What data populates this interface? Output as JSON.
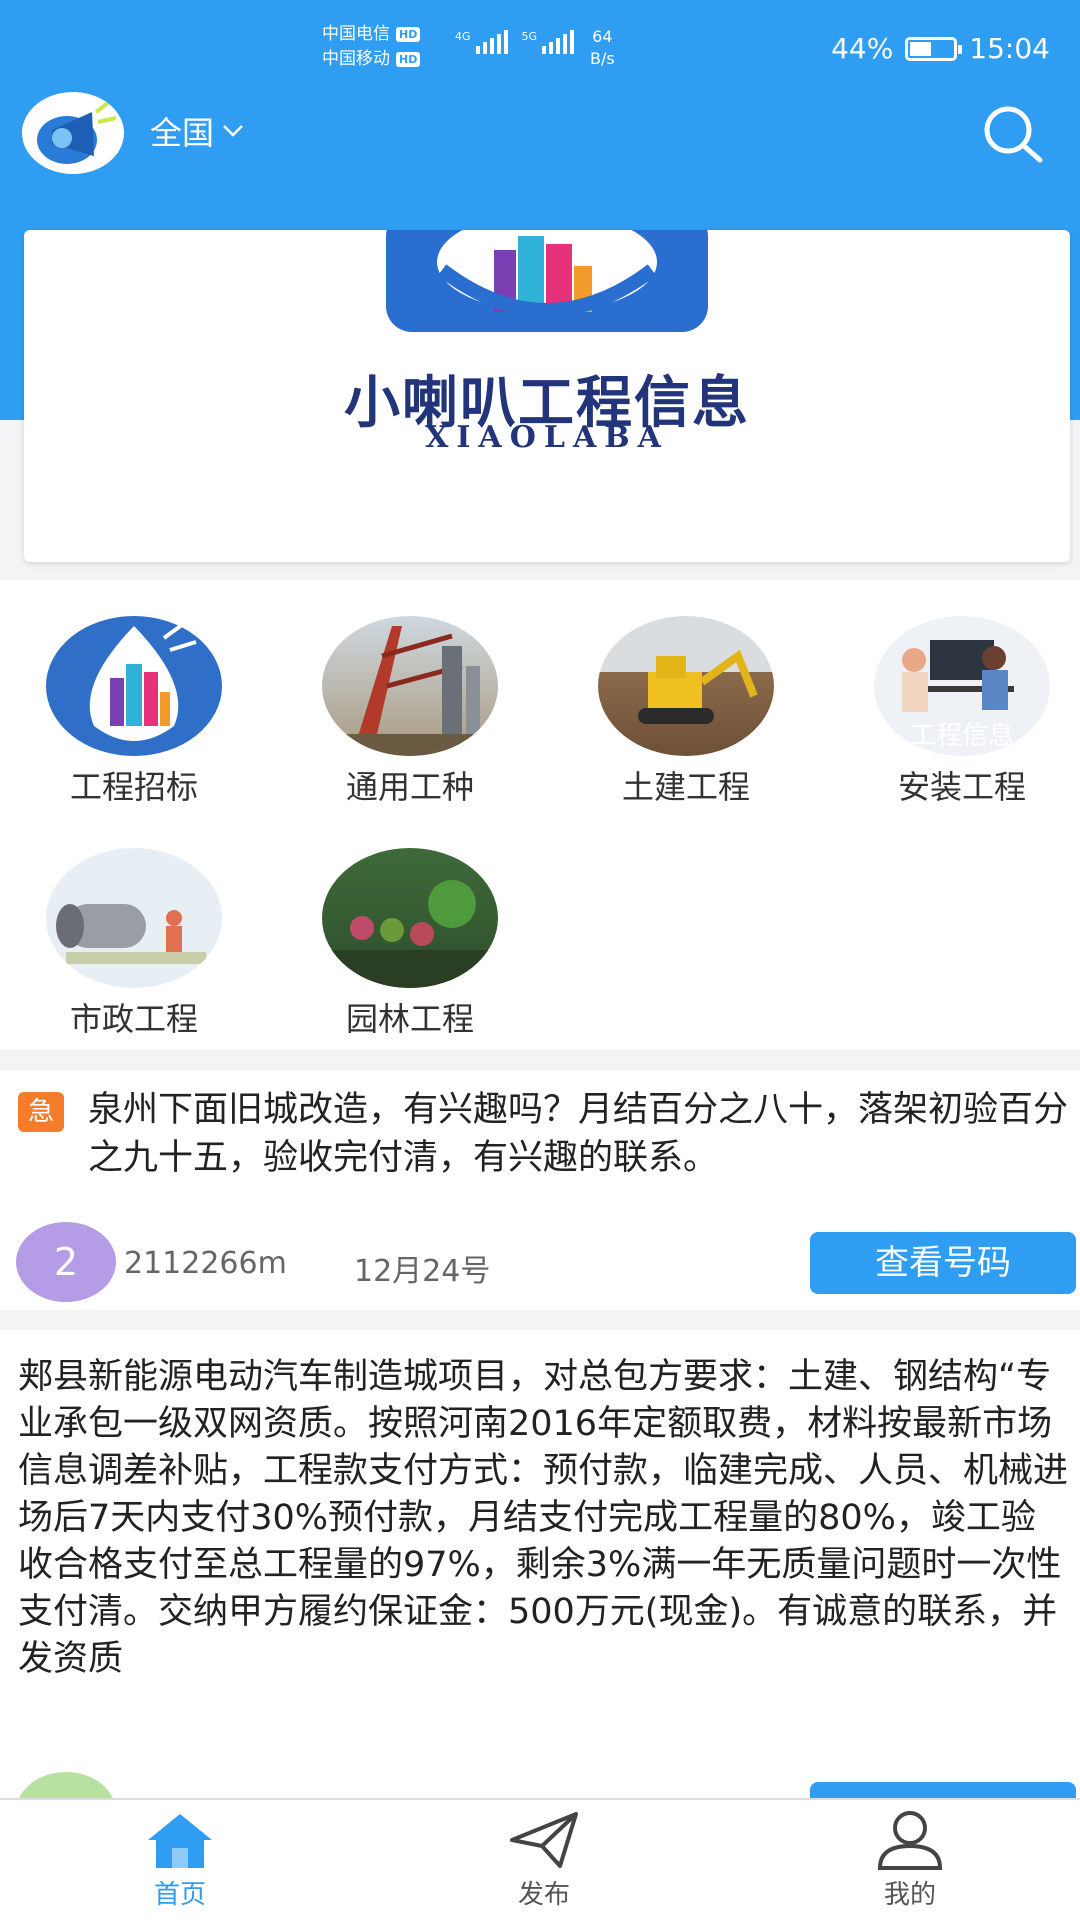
{
  "status_bar": {
    "carrier_1": "中国电信",
    "carrier_2": "中国移动",
    "hd": "HD",
    "net_1": "4G",
    "net_2": "5G",
    "speed_value": "64",
    "speed_unit": "B/s",
    "battery": "44%",
    "battery_level": 0.44,
    "time": "15:04"
  },
  "app_bar": {
    "region": "全国",
    "logo_icon": "megaphone-logo",
    "search_icon": "search-icon"
  },
  "banner": {
    "title": "小喇叭工程信息",
    "subtitle": "XIAOLABA"
  },
  "categories": [
    {
      "label": "工程招标",
      "icon": "megaphone-icon"
    },
    {
      "label": "通用工种",
      "icon": "crane-icon"
    },
    {
      "label": "土建工程",
      "icon": "excavator-icon"
    },
    {
      "label": "安装工程",
      "icon": "workers-icon",
      "overlay": "工程信息"
    },
    {
      "label": "市政工程",
      "icon": "pipe-icon"
    },
    {
      "label": "园林工程",
      "icon": "garden-icon"
    }
  ],
  "posts": [
    {
      "badge": "急",
      "text": "泉州下面旧城改造，有兴趣吗？月结百分之八十，落架初验百分之九十五，验收完付清，有兴趣的联系。",
      "avatar": "2",
      "user": "2112266m",
      "date": "12月24号",
      "button": "查看号码",
      "avatar_color": "#b59ce6"
    },
    {
      "text": "郏县新能源电动汽车制造城项目，对总包方要求：土建、钢结构“专业承包一级双网资质。按照河南2016年定额取费，材料按最新市场信息调差补贴，工程款支付方式：预付款，临建完成、人员、机械进场后7天内支付30%预付款，月结支付完成工程量的80%，竣工验收合格支付至总工程量的97%，剩余3%满一年无质量问题时一次性支付清。交纳甲方履约保证金：500万元(现金)。有诚意的联系，并发资质",
      "avatar_color": "#b8e0a0"
    }
  ],
  "tab_bar": {
    "home": "首页",
    "publish": "发布",
    "mine": "我的",
    "active_color": "#2f9df2",
    "inactive_color": "#555555"
  }
}
